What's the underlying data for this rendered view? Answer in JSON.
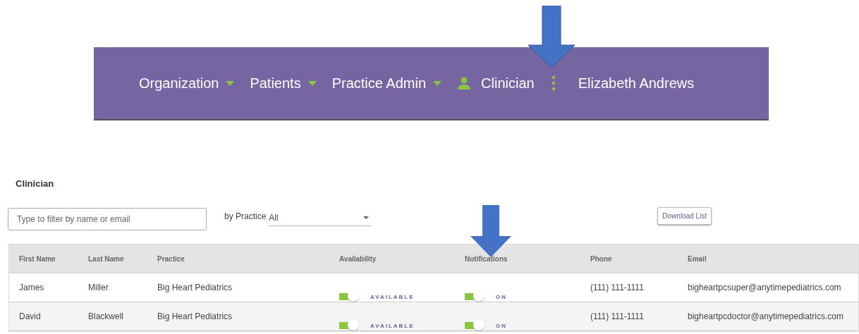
{
  "navbar": {
    "items": [
      {
        "label": "Organization",
        "kind": "dropdown"
      },
      {
        "label": "Patients",
        "kind": "dropdown"
      },
      {
        "label": "Practice Admin",
        "kind": "dropdown"
      },
      {
        "label": "Clinician",
        "kind": "person"
      },
      {
        "label": "Elizabeth Andrews",
        "kind": "more"
      }
    ]
  },
  "page_title": "Clinician",
  "filter": {
    "placeholder": "Type to filter by name or email"
  },
  "practice_filter": {
    "label": "by Practice",
    "value": "All"
  },
  "download_button": "Download List",
  "table": {
    "columns": [
      "First Name",
      "Last Name",
      "Practice",
      "Availability",
      "Notifications",
      "Phone",
      "Email"
    ],
    "rows": [
      {
        "first": "James",
        "last": "Miller",
        "practice": "Big Heart Pediatrics",
        "availability": {
          "label": "AVAILABLE",
          "on": true
        },
        "notifications": {
          "label": "ON",
          "on": true
        },
        "phone": "(111) 111-1111",
        "email": "bigheartpcsuper@anytimepediatrics.com"
      },
      {
        "first": "David",
        "last": "Blackwell",
        "practice": "Big Heart Pediatrics",
        "availability": {
          "label": "AVAILABLE",
          "on": true
        },
        "notifications": {
          "label": "ON",
          "on": true
        },
        "phone": "(111) 111-1111",
        "email": "bigheartpcdoctor@anytimepediatrics.com"
      }
    ]
  }
}
